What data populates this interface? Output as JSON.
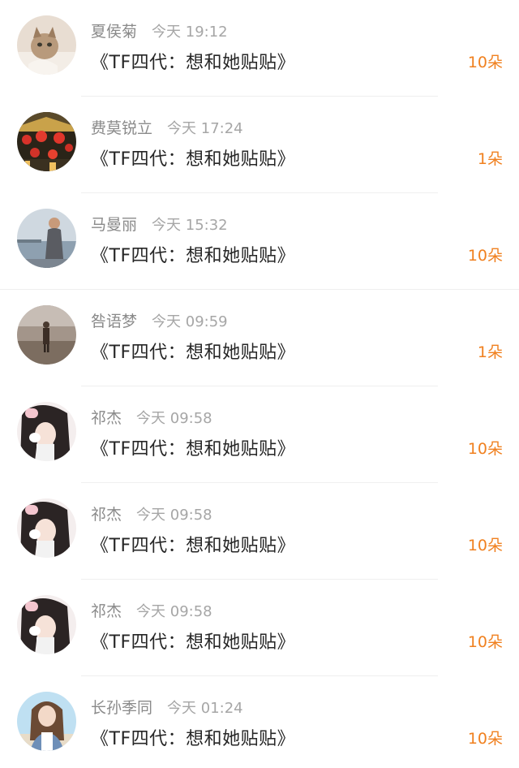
{
  "records": [
    {
      "name": "夏侯菊",
      "time": "今天 19:12",
      "gift": "《TF四代：想和她贴贴》",
      "amount": "10朵",
      "avatar": "kitten-photo-avatar"
    },
    {
      "name": "费莫锐立",
      "time": "今天 17:24",
      "gift": "《TF四代：想和她贴贴》",
      "amount": "1朵",
      "avatar": "lanterns-photo-avatar"
    },
    {
      "name": "马曼丽",
      "time": "今天 15:32",
      "gift": "《TF四代：想和她贴贴》",
      "amount": "10朵",
      "avatar": "seaside-person-avatar"
    },
    {
      "name": "咎语梦",
      "time": "今天 09:59",
      "gift": "《TF四代：想和她贴贴》",
      "amount": "1朵",
      "avatar": "field-person-avatar"
    },
    {
      "name": "祁杰",
      "time": "今天 09:58",
      "gift": "《TF四代：想和她贴贴》",
      "amount": "10朵",
      "avatar": "girl-selfie-avatar"
    },
    {
      "name": "祁杰",
      "time": "今天 09:58",
      "gift": "《TF四代：想和她贴贴》",
      "amount": "10朵",
      "avatar": "girl-selfie-avatar"
    },
    {
      "name": "祁杰",
      "time": "今天 09:58",
      "gift": "《TF四代：想和她贴贴》",
      "amount": "10朵",
      "avatar": "girl-selfie-avatar"
    },
    {
      "name": "长孙季同",
      "time": "今天 01:24",
      "gift": "《TF四代：想和她贴贴》",
      "amount": "10朵",
      "avatar": "beach-girl-avatar"
    }
  ],
  "colors": {
    "name": "#8a8a8a",
    "time": "#a6a6a6",
    "gift": "#262626",
    "amount": "#f0801f",
    "divider": "#efefef"
  }
}
